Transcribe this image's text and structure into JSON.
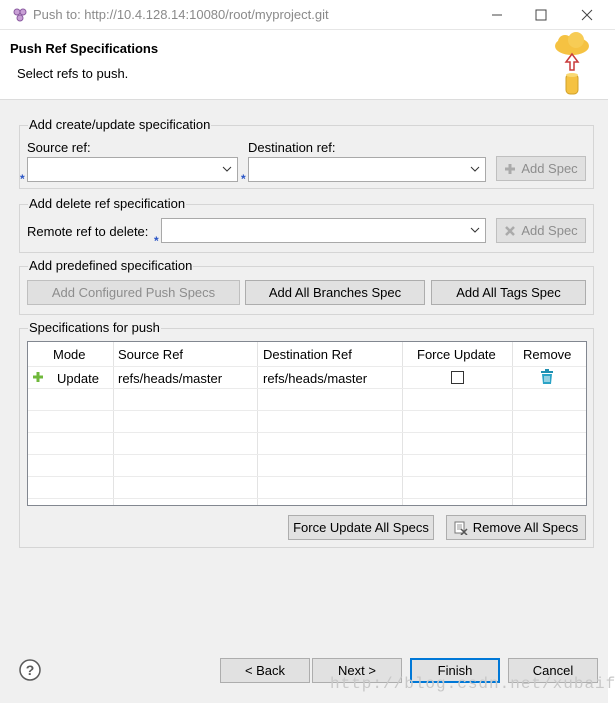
{
  "window": {
    "title": "Push to: http://10.4.128.14:10080/root/myproject.git",
    "icon": "git-push-icon"
  },
  "header": {
    "title": "Push Ref Specifications",
    "subtitle": "Select refs to push."
  },
  "create_group": {
    "label": "Add create/update specification",
    "source_label": "Source ref:",
    "source_value": "",
    "destination_label": "Destination ref:",
    "destination_value": "",
    "add_spec_label": "Add Spec"
  },
  "delete_group": {
    "label": "Add delete ref specification",
    "remote_label": "Remote ref to delete:",
    "remote_value": "",
    "add_spec_label": "Add Spec"
  },
  "predefined_group": {
    "label": "Add predefined specification",
    "buttons": [
      "Add Configured Push Specs",
      "Add All Branches Spec",
      "Add All Tags Spec"
    ]
  },
  "specs_group": {
    "label": "Specifications for push",
    "columns": [
      "Mode",
      "Source Ref",
      "Destination Ref",
      "Force Update",
      "Remove"
    ],
    "rows": [
      {
        "mode": "Update",
        "source": "refs/heads/master",
        "destination": "refs/heads/master",
        "force": false
      }
    ],
    "force_all_label": "Force Update All Specs",
    "remove_all_label": "Remove All Specs"
  },
  "footer": {
    "back_label": "< Back",
    "next_label": "Next >",
    "finish_label": "Finish",
    "cancel_label": "Cancel"
  },
  "watermark": "http://blog.csdn.net/xubaifu",
  "colors": {
    "accent": "#0078d7",
    "required_marker": "#2a55c6"
  }
}
